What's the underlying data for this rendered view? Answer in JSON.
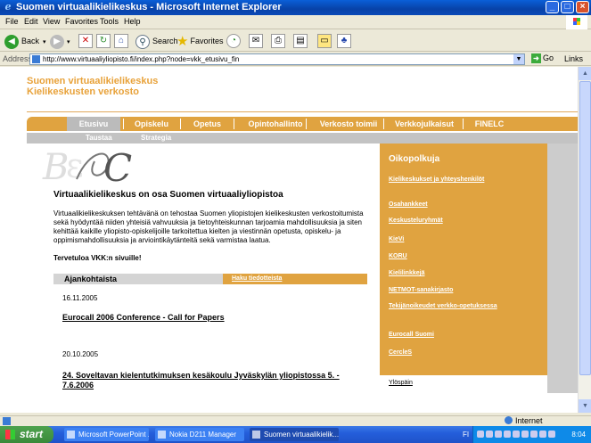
{
  "window": {
    "title": "Suomen virtuaalikielikeskus - Microsoft Internet Explorer",
    "minimize": "_",
    "maximize": "□",
    "close": "×"
  },
  "menu": [
    "File",
    "Edit",
    "View",
    "Favorites",
    "Tools",
    "Help"
  ],
  "toolbar": {
    "back": "Back",
    "search": "Search",
    "favorites": "Favorites"
  },
  "address": {
    "label": "Address",
    "url": "http://www.virtuaaliyliopisto.fi/index.php?node=vkk_etusivu_fin",
    "go": "Go",
    "links": "Links"
  },
  "page": {
    "brand_line1": "Suomen virtuaalikielikeskus",
    "brand_line2": "Kielikeskusten verkosto",
    "nav": [
      "Etusivu",
      "Opiskelu",
      "Opetus",
      "Opintohallinto",
      "Verkosto toimii",
      "Verkkojulkaisut",
      "FINELC"
    ],
    "subnav": [
      "Taustaa",
      "Strategia"
    ],
    "heading": "Virtuaalikielikeskus on osa Suomen virtuaaliyliopistoa",
    "intro": "Virtuaalikielikeskuksen tehtävänä on tehostaa Suomen yliopistojen kielikeskusten verkostoitumista sekä hyödyntää niiden yhteisiä vahvuuksia ja tietoyhteiskunnan tarjoamia mahdollisuuksia ja siten kehittää kaikille yliopisto-opiskelijoille tarkoitettua kielten ja viestinnän opetusta, opiskelu- ja oppimismahdollisuuksia ja arviointikäytänteitä sekä varmistaa laatua.",
    "welcome": "Tervetuloa VKK:n sivuille!",
    "news_header": "Ajankohtaista",
    "news_search": "Haku tiedotteista",
    "news": [
      {
        "date": "16.11.2005",
        "title": "Eurocall 2006 Conference - Call for Papers"
      },
      {
        "date": "20.10.2005",
        "title": "24. Soveltavan kielentutkimuksen kesäkoulu Jyväskylän yliopistossa 5. - 7.6.2006"
      }
    ],
    "sidebar_title": "Oikopolkuja",
    "sidebar_links": [
      "Kielikeskukset ja yhteyshenkilöt",
      "Osahankkeet",
      "Keskusteluryhmät",
      "KieVi",
      "KORU",
      "Kielilinkkejä",
      "NETMOT-sanakirjasto",
      "Tekijänoikeudet verkko-opetuksessa",
      "Eurocall Suomi",
      "CercleS"
    ],
    "back_to_top": "Ylöspäin"
  },
  "status": {
    "zone": "Internet"
  },
  "taskbar": {
    "start": "start",
    "tasks": [
      "Microsoft PowerPoint ...",
      "Nokia D211 Manager",
      "Suomen virtuaalikielik..."
    ],
    "lang": "FI",
    "clock": "8:04"
  }
}
